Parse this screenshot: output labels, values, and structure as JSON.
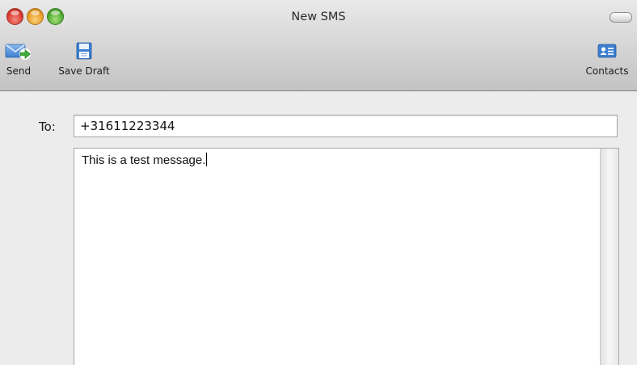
{
  "window": {
    "title": "New SMS"
  },
  "colors": {
    "toolbar_icon_blue": "#3d7fd1",
    "send_arrow_green": "#3fae3a"
  },
  "toolbar": {
    "send": {
      "label": "Send",
      "icon": "envelope-send-icon"
    },
    "save_draft": {
      "label": "Save Draft",
      "icon": "floppy-disk-icon"
    },
    "contacts": {
      "label": "Contacts",
      "icon": "address-card-icon"
    }
  },
  "form": {
    "to_label": "To:",
    "to_value": "+31611223344",
    "message": "This is a test message."
  }
}
